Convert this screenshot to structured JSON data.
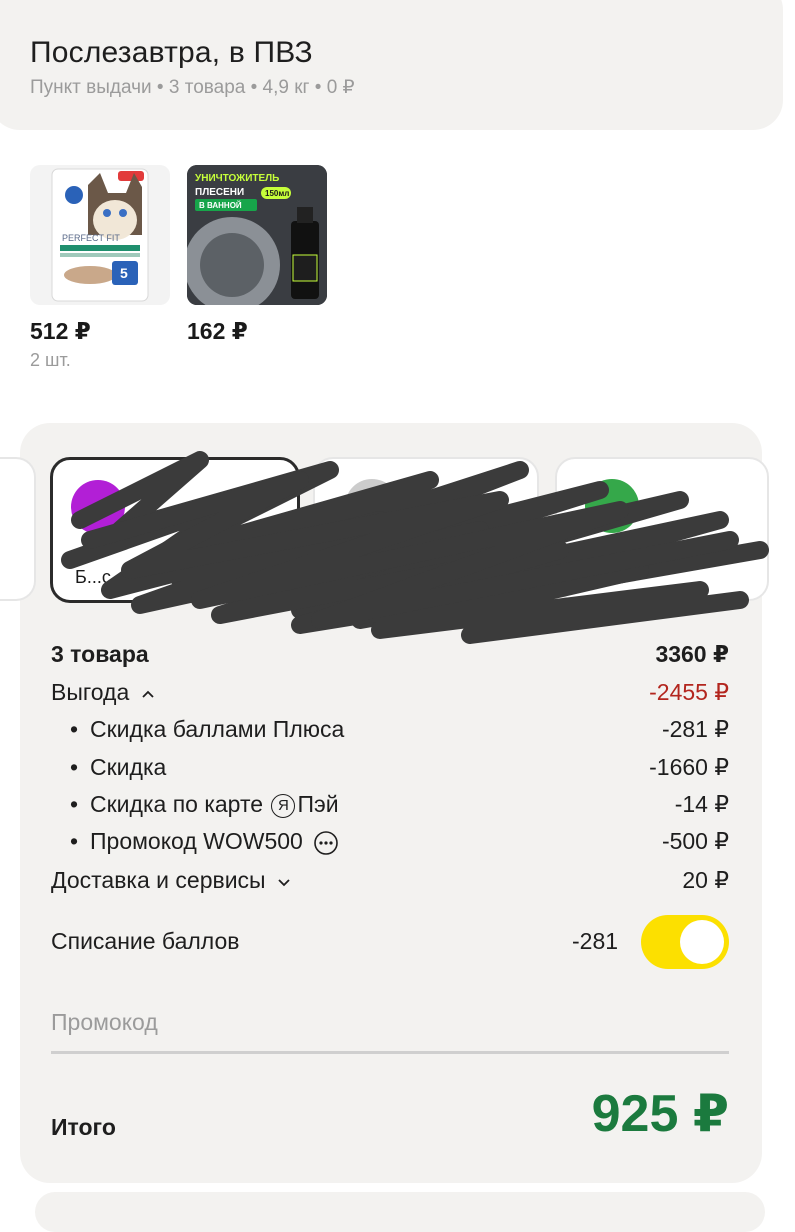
{
  "delivery": {
    "title": "Послезавтра, в ПВЗ",
    "subtitle": "Пункт выдачи • 3 товара • 4,9 кг • 0 ₽"
  },
  "items": [
    {
      "product_text": "PERFECT FIT",
      "price": "512 ₽",
      "qty": "2 шт."
    },
    {
      "product_text_1": "УНИЧТОЖИТЕЛЬ",
      "product_text_2": "ПЛЕСЕНИ",
      "product_text_3": "В ВАННОЙ",
      "product_badge": "150мл",
      "price": "162 ₽"
    }
  ],
  "payment": {
    "tiles": [
      {
        "label": "Б...с...",
        "logo_color": "#b21fd6",
        "selected": true
      },
      {
        "label": "",
        "logo_color": "#cccccc",
        "selected": false
      },
      {
        "label": "",
        "logo_color": "#35a84a",
        "selected": false
      }
    ]
  },
  "summary": {
    "goods_label": "3 товара",
    "goods_value": "3360 ₽",
    "savings_label": "Выгода",
    "savings_value": "-2455 ₽",
    "lines": [
      {
        "label": "Скидка баллами Плюса",
        "value": "-281 ₽"
      },
      {
        "label": "Скидка",
        "value": "-1660 ₽"
      },
      {
        "label": "Скидка по карте",
        "brand": "Я",
        "label_after": "Пэй",
        "value": "-14 ₽"
      },
      {
        "label": "Промокод WOW500",
        "value": "-500 ₽"
      }
    ],
    "delivery_label": "Доставка и сервисы",
    "delivery_value": "20 ₽"
  },
  "points": {
    "label": "Списание баллов",
    "value": "-281",
    "toggle_on": true,
    "toggle_color": "#fce000"
  },
  "promo": {
    "placeholder": "Промокод"
  },
  "total": {
    "label": "Итого",
    "value": "925 ₽",
    "color": "#1b7a3e"
  },
  "colors": {
    "card_bg": "#f3f2f0",
    "negative": "#b3261e"
  }
}
